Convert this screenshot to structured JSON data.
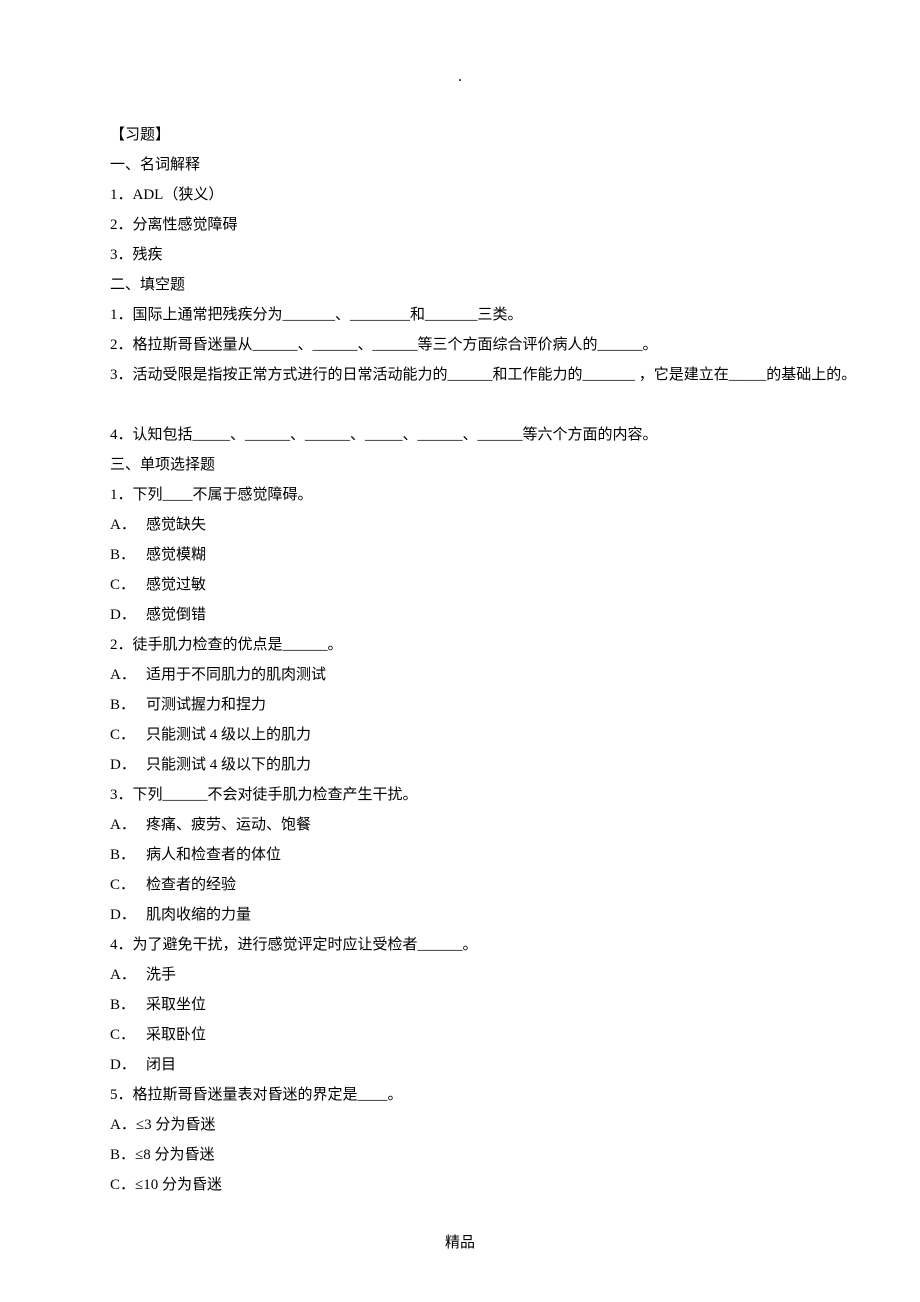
{
  "topdot": ".",
  "header_title": "【习题】",
  "section1_title": "一、名词解释",
  "s1_q1": "1．ADL（狭义）",
  "s1_q2": "2．分离性感觉障碍",
  "s1_q3": "3．残疾",
  "section2_title": "二、填空题",
  "s2_q1": "1．国际上通常把残疾分为_______、________和_______三类。",
  "s2_q2": "2．格拉斯哥昏迷量从______、______、______等三个方面综合评价病人的______。",
  "s2_q3": "3．活动受限是指按正常方式进行的日常活动能力的______和工作能力的_______ ，它是建立在_____的基础上的。",
  "s2_q4": "4．认知包括_____、______、______、_____、______、______等六个方面的内容。",
  "section3_title": "三、单项选择题",
  "s3_q1": "1．下列____不属于感觉障碍。",
  "s3_q1_A": {
    "letter": "A．",
    "text": "感觉缺失"
  },
  "s3_q1_B": {
    "letter": "B．",
    "text": "感觉模糊"
  },
  "s3_q1_C": {
    "letter": "C．",
    "text": "感觉过敏"
  },
  "s3_q1_D": {
    "letter": "D．",
    "text": "感觉倒错"
  },
  "s3_q2": "2．徒手肌力检查的优点是______。",
  "s3_q2_A": {
    "letter": "A．",
    "text": "适用于不同肌力的肌肉测试"
  },
  "s3_q2_B": {
    "letter": "B．",
    "text": "可测试握力和捏力"
  },
  "s3_q2_C": {
    "letter": "C．",
    "text": "只能测试 4 级以上的肌力"
  },
  "s3_q2_D": {
    "letter": "D．",
    "text": "只能测试 4 级以下的肌力"
  },
  "s3_q3": "3．下列______不会对徒手肌力检查产生干扰。",
  "s3_q3_A": {
    "letter": "A．",
    "text": "疼痛、疲劳、运动、饱餐"
  },
  "s3_q3_B": {
    "letter": "B．",
    "text": "病人和检查者的体位"
  },
  "s3_q3_C": {
    "letter": "C．",
    "text": "检查者的经验"
  },
  "s3_q3_D": {
    "letter": "D．",
    "text": "肌肉收缩的力量"
  },
  "s3_q4": "4．为了避免干扰，进行感觉评定时应让受检者______。",
  "s3_q4_A": {
    "letter": "A．",
    "text": "洗手"
  },
  "s3_q4_B": {
    "letter": "B．",
    "text": "采取坐位"
  },
  "s3_q4_C": {
    "letter": "C．",
    "text": "采取卧位"
  },
  "s3_q4_D": {
    "letter": "D．",
    "text": "闭目"
  },
  "s3_q5": "5．格拉斯哥昏迷量表对昏迷的界定是____。",
  "s3_q5_A": "A．≤3 分为昏迷",
  "s3_q5_B": "B．≤8 分为昏迷",
  "s3_q5_C": "C．≤10 分为昏迷",
  "footer": "精品"
}
